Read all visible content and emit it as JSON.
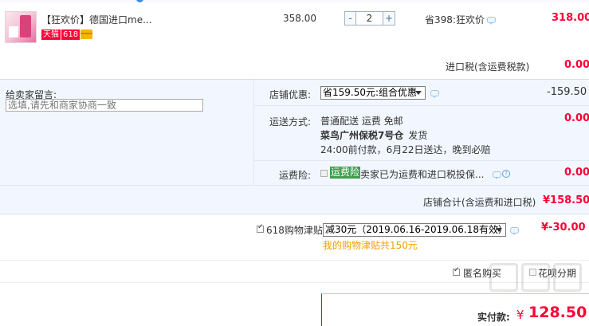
{
  "item": {
    "title": "【狂欢价】德国进口me...",
    "badge_tmall": "天猫",
    "badge_618": "618",
    "unit_price": "358.00",
    "qty_minus": "-",
    "qty_value": "2",
    "qty_plus": "+",
    "promo": "省398:狂欢价",
    "subtotal": "318.00"
  },
  "tax": {
    "label": "进口税(含运费税款)",
    "value": "0.00"
  },
  "message": {
    "label": "给卖家留言:",
    "placeholder": "选填,请先和商家协商一致"
  },
  "discount": {
    "label": "店铺优惠:",
    "selected": "省159.50元:组合优惠",
    "value": "-159.50"
  },
  "shipping": {
    "label": "运送方式:",
    "method": "普通配送 运费 免邮",
    "warehouse": "菜鸟广州保税7号仓",
    "warehouse_suffix": "发货",
    "eta": "24:00前付款，6月22日送达，晚到必赔",
    "value": "0.00"
  },
  "insurance": {
    "label": "运费险:",
    "tag": "运费险",
    "desc": "卖家已为运费和进口税投保...",
    "value": "0.00"
  },
  "shop_total": {
    "label": "店铺合计(含运费和进口税)",
    "value": "¥158.50"
  },
  "allowance": {
    "label": "618购物津贴",
    "selected": "减30元（2019.06.16-2019.06.18有效）",
    "note": "我的购物津贴共150元",
    "value": "¥-30.00"
  },
  "options": {
    "anonymous": "匿名购买",
    "huabei": "花呗分期"
  },
  "payment": {
    "label": "实付款:",
    "currency": "¥",
    "amount": "128.50"
  },
  "colors": {
    "accent_red": "#ff0036",
    "panel_bg": "#f2f7ff",
    "orange_note": "#f5a000"
  }
}
